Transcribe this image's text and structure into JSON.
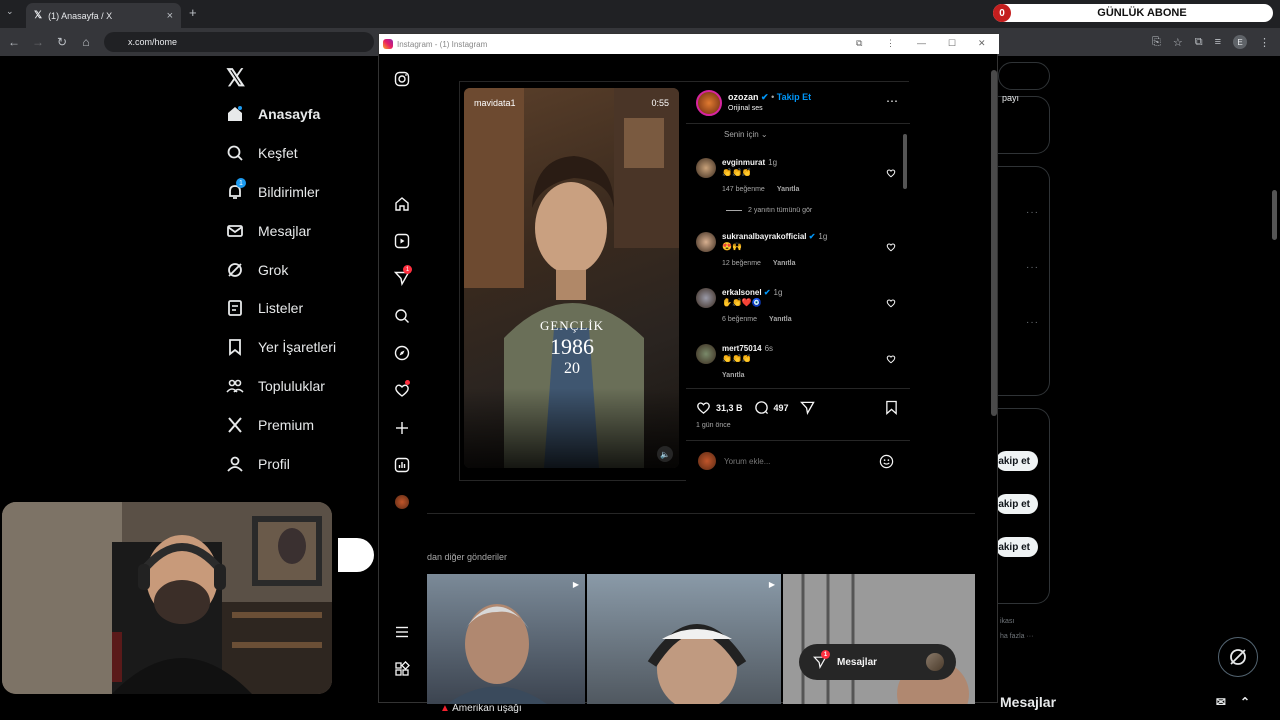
{
  "browser": {
    "tab_title": "(1) Anasayfa / X",
    "tab_close": "×",
    "new_tab": "+",
    "url": "x.com/home",
    "profile_initial": "E"
  },
  "subscriber_widget": {
    "count": "0",
    "label": "GÜNLÜK ABONE"
  },
  "x_nav": {
    "items": [
      {
        "label": "Anasayfa",
        "icon": "home-icon",
        "active": true
      },
      {
        "label": "Keşfet",
        "icon": "search-icon"
      },
      {
        "label": "Bildirimler",
        "icon": "bell-icon",
        "badge": "1"
      },
      {
        "label": "Mesajlar",
        "icon": "mail-icon"
      },
      {
        "label": "Grok",
        "icon": "grok-icon"
      },
      {
        "label": "Listeler",
        "icon": "list-icon"
      },
      {
        "label": "Yer İşaretleri",
        "icon": "bookmark-icon"
      },
      {
        "label": "Topluluklar",
        "icon": "communities-icon"
      },
      {
        "label": "Premium",
        "icon": "x-premium-icon"
      },
      {
        "label": "Profil",
        "icon": "profile-icon"
      }
    ]
  },
  "x_right": {
    "top_text": "payı",
    "follow_label": "akip et",
    "footer_1": "ikası",
    "footer_2": "ha fazla ···",
    "messages_label": "Mesajlar",
    "trend_label": "Amerikan uşağı"
  },
  "instagram": {
    "window_title": "Instagram - (1) Instagram",
    "left_nav_badge": "1",
    "post": {
      "video_username": "mavidata1",
      "video_time": "0:55",
      "video_overlay_lines": [
        "GENÇLİK",
        "1986",
        "20"
      ],
      "author": "ozozan",
      "follow": "Takip Et",
      "audio": "Orijinal ses",
      "sort": "Senin için",
      "comments": [
        {
          "user": "evginmurat",
          "time": "1g",
          "text": "👏👏👏",
          "likes": "147 beğenme",
          "reply": "Yanıtla"
        },
        {
          "user": "sukranalbayrakofficial",
          "verified": true,
          "time": "1g",
          "text": "😍🙌",
          "likes": "12 beğenme",
          "reply": "Yanıtla"
        },
        {
          "user": "erkalsonel",
          "verified": true,
          "time": "1g",
          "text": "✋👏❤️🧿",
          "likes": "6 beğenme",
          "reply": "Yanıtla"
        },
        {
          "user": "mert75014",
          "time": "6s",
          "text": "👏👏👏",
          "likes": "",
          "reply": "Yanıtla"
        }
      ],
      "view_replies": "2 yanıtın tümünü gör",
      "like_count": "31,3 B",
      "comment_count": "497",
      "posted": "1 gün önce",
      "comment_placeholder": "Yorum ekle..."
    },
    "more_posts_label": "dan diğer gönderiler",
    "messages_pill": {
      "label": "Mesajlar",
      "badge": "1"
    }
  }
}
